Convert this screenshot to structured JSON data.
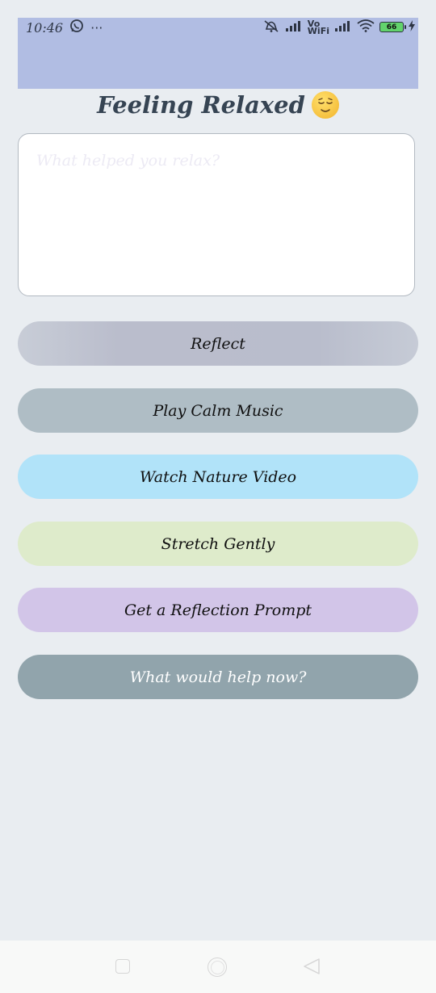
{
  "status_bar": {
    "time": "10:46",
    "more": "···",
    "volte": "Vo",
    "wifi_label": "WiFi",
    "battery": "66",
    "icons": [
      "whatsapp-icon",
      "mute-icon",
      "signal-icon",
      "wifi-icon",
      "battery-icon",
      "charging-icon"
    ]
  },
  "header": {
    "title": "Feeling Relaxed",
    "emoji": "relieved-face-emoji"
  },
  "reflection": {
    "placeholder": "What helped you relax?"
  },
  "actions": {
    "reflect": "Reflect",
    "play_music": "Play Calm Music",
    "watch_video": "Watch Nature Video",
    "stretch": "Stretch Gently",
    "reflection_prompt": "Get a Reflection Prompt",
    "help_now": "What would help now?"
  },
  "colors": {
    "status_bar": "#b1bde3",
    "background": "#e9edf1",
    "reflect": "#b9bdcc",
    "music": "#afbdc5",
    "video": "#b1e3f9",
    "stretch": "#deebcb",
    "prompt": "#d2c5e8",
    "help": "#91a4ac"
  },
  "nav": {
    "icons": [
      "recent-apps-icon",
      "home-icon",
      "back-icon"
    ]
  }
}
